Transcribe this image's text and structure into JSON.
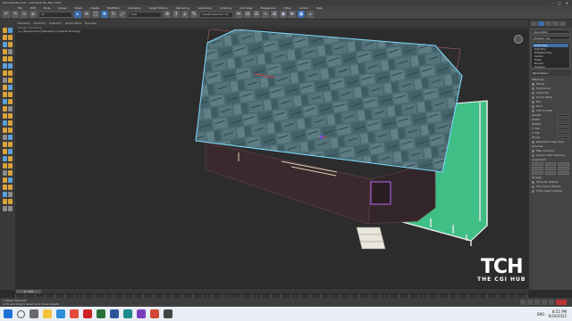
{
  "window": {
    "title": "table Render.max - Autodesk 3ds Max 2021",
    "controls": [
      "–",
      "□",
      "✕"
    ]
  },
  "menu": [
    "File",
    "Edit",
    "Tools",
    "Group",
    "Views",
    "Create",
    "Modifiers",
    "Animation",
    "Graph Editors",
    "Rendering",
    "Customize",
    "Scripting",
    "Civil View",
    "Megascans",
    "V-Ray",
    "Arnold",
    "Help"
  ],
  "toolbar": {
    "selection_filter": "All",
    "create_selection_set": "Create Selection Se",
    "view_dropdown": "View"
  },
  "ribbon": {
    "tabs": [
      "Modeling",
      "Freeform",
      "Selection",
      "Object Paint",
      "Populate"
    ],
    "subtitle": "Polygon Modeling"
  },
  "viewport": {
    "label": "[+] [Perspective] [Standard] [Default Shading]",
    "watermark_logo": "TCH",
    "watermark_text": "THE CGI HUB"
  },
  "command_panel": {
    "object_name": "Object009",
    "modifier_list": "Modifier List",
    "stack": [
      "UVW Map",
      "Edit Poly",
      "Editable Poly",
      "Vertex",
      "Edge",
      "Border",
      "Polygon",
      "Element"
    ],
    "rollout_title": "Parameters",
    "mapping_label": "Mapping:",
    "mapping_options": [
      "Planar",
      "Cylindrical",
      "Spherical",
      "Shrink Wrap",
      "Box",
      "Face",
      "XYZ to UVW"
    ],
    "fields": [
      "Length:",
      "Width:",
      "Height:",
      "U Tile:",
      "V Tile:",
      "W Tile:"
    ],
    "flip_label": "Flip",
    "real_world": "Real-World Map Size",
    "channel_label": "Channel:",
    "channel_options": [
      "Map Channel:",
      "Vertex Color Channel"
    ],
    "alignment_label": "Alignment:",
    "align_axes": [
      "X",
      "Y",
      "Z"
    ],
    "align_buttons": [
      "Manipulate",
      "Fit",
      "Center",
      "Bitmap Fit",
      "Normal Align",
      "View Align",
      "Region Fit",
      "Reset",
      "Acquire"
    ],
    "display_label": "Display:",
    "display_options": [
      "Show No Seams",
      "Thin Seam Display",
      "Thick Seam Display"
    ]
  },
  "timeline": {
    "frame_label": "0 / 100",
    "ticks": [
      "0",
      "5",
      "10",
      "15",
      "20",
      "25",
      "30",
      "35",
      "40",
      "45",
      "50",
      "55",
      "60",
      "65",
      "70",
      "75",
      "80",
      "85",
      "90",
      "95",
      "100"
    ]
  },
  "status": {
    "selection": "1 Object Selected",
    "prompt": "Click and drag to select and move objects",
    "autokey": "Auto Key",
    "selected_label": "Selected"
  },
  "taskbar": {
    "time": "8:51 PM",
    "date": "6/24/2022",
    "language": "ENG"
  },
  "colors": {
    "accent_blue": "#3d6ea8",
    "floor_green": "#3fbf86",
    "selection_cyan": "#7fd9ff",
    "roof_texture": "#4b6a72"
  }
}
